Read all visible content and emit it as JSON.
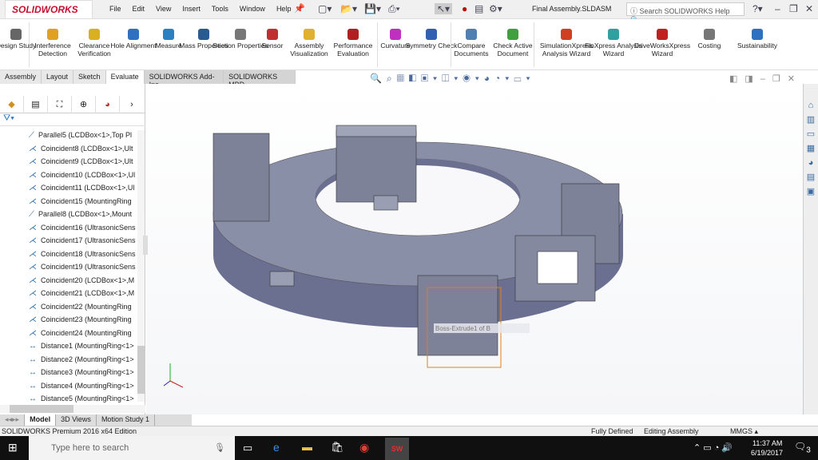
{
  "app": {
    "logo": "SOLIDWORKS",
    "title": "Final Assembly.SLDASM",
    "search_placeholder": "Search SOLIDWORKS Help"
  },
  "menu": [
    "File",
    "Edit",
    "View",
    "Insert",
    "Tools",
    "Window",
    "Help"
  ],
  "ribbon": [
    {
      "label": "Design Study",
      "color": "#666"
    },
    {
      "label": "Interference Detection",
      "color": "#e0a020"
    },
    {
      "label": "Clearance Verification",
      "color": "#d8b020"
    },
    {
      "label": "Hole Alignment",
      "color": "#3070c0"
    },
    {
      "label": "Measure",
      "color": "#2a80c0"
    },
    {
      "label": "Mass Properties",
      "color": "#2a5a90"
    },
    {
      "label": "Section Properties",
      "color": "#777"
    },
    {
      "label": "Sensor",
      "color": "#c03030"
    },
    {
      "label": "Assembly Visualization",
      "color": "#e0b030"
    },
    {
      "label": "Performance Evaluation",
      "color": "#b02020"
    },
    {
      "label": "Curvature",
      "color": "#c030c0"
    },
    {
      "label": "Symmetry Check",
      "color": "#3060b0"
    },
    {
      "label": "Compare Documents",
      "color": "#5080b0"
    },
    {
      "label": "Check Active Document",
      "color": "#40a040"
    },
    {
      "label": "SimulationXpress Analysis Wizard",
      "color": "#d04020"
    },
    {
      "label": "FloXpress Analysis Wizard",
      "color": "#30a0a0"
    },
    {
      "label": "DriveWorksXpress Wizard",
      "color": "#c02020"
    },
    {
      "label": "Costing",
      "color": "#777"
    },
    {
      "label": "Sustainability",
      "color": "#3070c0"
    }
  ],
  "tabs": [
    "Assembly",
    "Layout",
    "Sketch",
    "Evaluate",
    "SOLIDWORKS Add-Ins",
    "SOLIDWORKS MBD"
  ],
  "active_tab": "Evaluate",
  "tree": [
    {
      "icon": "parallel",
      "label": "Parallel5 (LCDBox<1>,Top Pl"
    },
    {
      "icon": "coincident",
      "label": "Coincident8 (LCDBox<1>,Ult"
    },
    {
      "icon": "coincident",
      "label": "Coincident9 (LCDBox<1>,Ult"
    },
    {
      "icon": "coincident",
      "label": "Coincident10 (LCDBox<1>,Ul"
    },
    {
      "icon": "coincident",
      "label": "Coincident11 (LCDBox<1>,Ul"
    },
    {
      "icon": "coincident",
      "label": "Coincident15 (MountingRing"
    },
    {
      "icon": "parallel",
      "label": "Parallel8 (LCDBox<1>,Mount"
    },
    {
      "icon": "coincident",
      "label": "Coincident16 (UltrasonicSens"
    },
    {
      "icon": "coincident",
      "label": "Coincident17 (UltrasonicSens"
    },
    {
      "icon": "coincident",
      "label": "Coincident18 (UltrasonicSens"
    },
    {
      "icon": "coincident",
      "label": "Coincident19 (UltrasonicSens"
    },
    {
      "icon": "coincident",
      "label": "Coincident20 (LCDBox<1>,M"
    },
    {
      "icon": "coincident",
      "label": "Coincident21 (LCDBox<1>,M"
    },
    {
      "icon": "coincident",
      "label": "Coincident22 (MountingRing"
    },
    {
      "icon": "coincident",
      "label": "Coincident23 (MountingRing"
    },
    {
      "icon": "coincident",
      "label": "Coincident24 (MountingRing"
    },
    {
      "icon": "distance",
      "label": "Distance1 (MountingRing<1>"
    },
    {
      "icon": "distance",
      "label": "Distance2 (MountingRing<1>"
    },
    {
      "icon": "distance",
      "label": "Distance3 (MountingRing<1>"
    },
    {
      "icon": "distance",
      "label": "Distance4 (MountingRing<1>"
    },
    {
      "icon": "distance",
      "label": "Distance5 (MountingRing<1>"
    }
  ],
  "viewport": {
    "tooltip": "Boss-Extrude1 of B",
    "model_color": "#8a8fa8"
  },
  "bottom_tabs": [
    "Model",
    "3D Views",
    "Motion Study 1"
  ],
  "status": {
    "edition": "SOLIDWORKS Premium 2016 x64 Edition",
    "defined": "Fully Defined",
    "mode": "Editing Assembly",
    "units": "MMGS"
  },
  "taskbar": {
    "search": "Type here to search",
    "time": "11:37 AM",
    "date": "6/19/2017",
    "notifications": "3"
  }
}
